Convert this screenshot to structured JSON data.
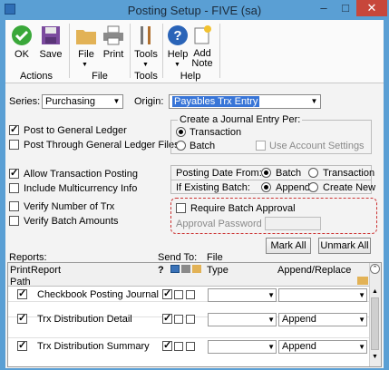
{
  "window": {
    "title": "Posting Setup  -  FIVE (sa)",
    "minimize": "–",
    "maximize": "□",
    "close": "✕"
  },
  "ribbon": {
    "ok": "OK",
    "save": "Save",
    "file": "File",
    "print": "Print",
    "tools": "Tools",
    "help": "Help",
    "add_note": "Add\nNote",
    "groups": {
      "actions": "Actions",
      "file": "File",
      "tools": "Tools",
      "help": "Help"
    }
  },
  "form": {
    "series_label": "Series:",
    "series_value": "Purchasing",
    "origin_label": "Origin:",
    "origin_value": "Payables Trx Entry",
    "post_to_gl": "Post to General Ledger",
    "post_through_gl": "Post Through General Ledger Files",
    "journal_entry_per": "Create a Journal Entry Per:",
    "transaction": "Transaction",
    "batch": "Batch",
    "use_account_settings": "Use Account Settings",
    "allow_transaction_posting": "Allow Transaction Posting",
    "include_multicurrency": "Include Multicurrency Info",
    "posting_date_from": "Posting Date From:",
    "pd_batch": "Batch",
    "pd_transaction": "Transaction",
    "if_existing_batch": "If Existing Batch:",
    "append": "Append",
    "create_new": "Create New",
    "verify_number_of_trx": "Verify Number of Trx",
    "verify_batch_amounts": "Verify Batch Amounts",
    "require_batch_approval": "Require Batch Approval",
    "approval_password": "Approval Password"
  },
  "reports": {
    "reports_label": "Reports:",
    "send_to_label": "Send To:",
    "file_label": "File",
    "mark_all": "Mark All",
    "unmark_all": "Unmark All",
    "col_print": "Print",
    "col_report": "Report",
    "col_help": "?",
    "col_type": "Type",
    "col_append": "Append/Replace",
    "col_path": "Path",
    "rows": [
      {
        "report": "Checkbook Posting Journal",
        "append": ""
      },
      {
        "report": "Trx Distribution Detail",
        "append": "Append"
      },
      {
        "report": "Trx Distribution Summary",
        "append": "Append"
      }
    ]
  }
}
